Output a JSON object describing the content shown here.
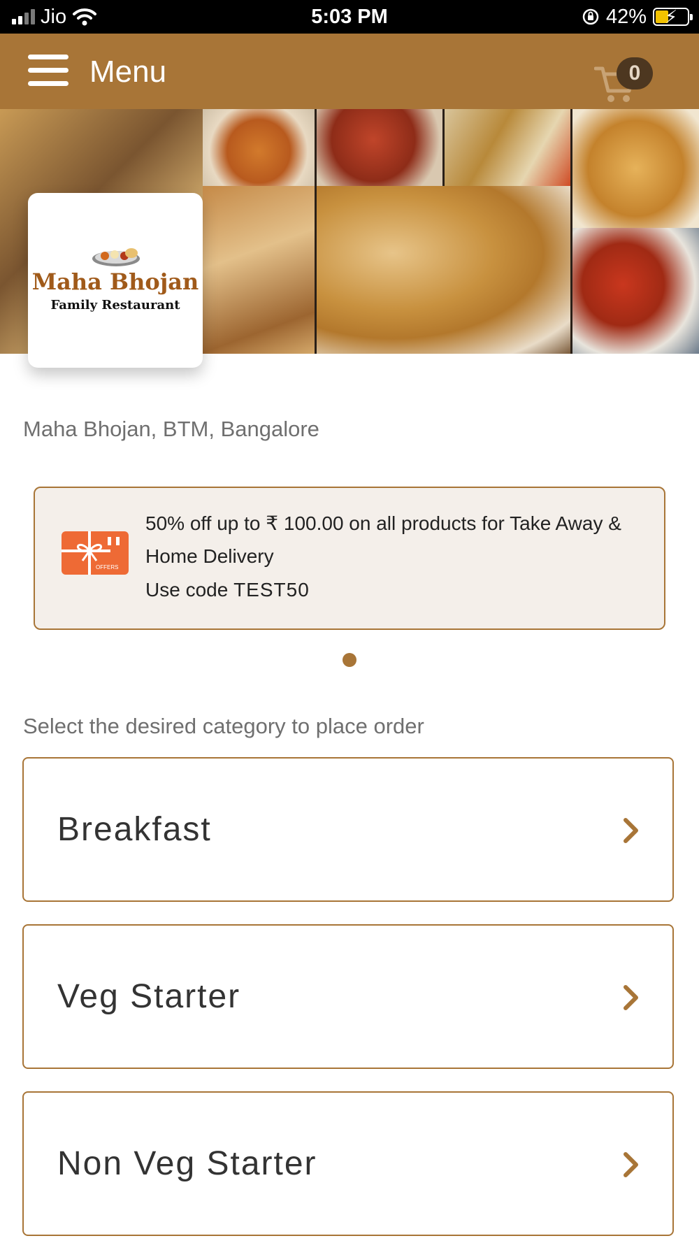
{
  "status_bar": {
    "carrier": "Jio",
    "time": "5:03 PM",
    "battery_percent": "42%",
    "icons": [
      "signal-icon",
      "wifi-icon",
      "orientation-lock-icon",
      "battery-charging-icon"
    ]
  },
  "header": {
    "menu_icon": "hamburger-icon",
    "title": "Menu",
    "cart_icon": "cart-icon",
    "cart_count": "0"
  },
  "restaurant": {
    "logo_title": "Maha Bhojan",
    "logo_subtitle": "Family Restaurant",
    "location": "Maha Bhojan, BTM, Bangalore"
  },
  "offer": {
    "icon": "offers-ticket-icon",
    "line1": "50% off up to ₹ 100.00 on all products for Take Away &",
    "line2": "Home Delivery",
    "code_prefix": "Use code ",
    "code": "TEST50",
    "carousel": {
      "pages": 1,
      "active": 1
    }
  },
  "category_prompt": "Select the desired category to place order",
  "categories": [
    {
      "label": "Breakfast"
    },
    {
      "label": "Veg Starter"
    },
    {
      "label": "Non Veg Starter"
    }
  ],
  "colors": {
    "brand": "#a87537",
    "cart_badge": "#4d3720",
    "offer_background": "#f4efea",
    "offer_icon": "#ee6a35"
  }
}
